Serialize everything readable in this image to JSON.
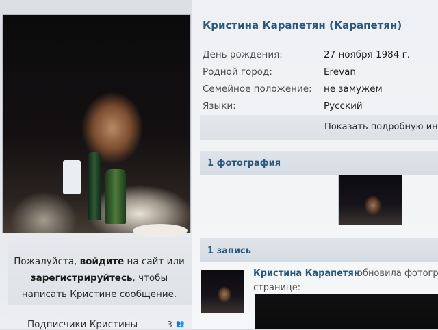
{
  "profile": {
    "name": "Кристина Карапетян (Карапетян)",
    "info": [
      {
        "label": "День рождения:",
        "value": "27 ноября 1984 г."
      },
      {
        "label": "Родной город:",
        "value": "Erevan"
      },
      {
        "label": "Семейное положение:",
        "value": "не замужем"
      },
      {
        "label": "Языки:",
        "value": "Русский"
      }
    ],
    "more_link": "Показать подробную инфо"
  },
  "login_prompt": {
    "line1_a": "Пожалуйста, ",
    "line1_link": "войдите",
    "line1_b": " на сайт или",
    "line2_link": "зарегистрируйтесь",
    "line2_b": ", чтобы",
    "line3": "написать Кристине сообщение."
  },
  "friends": {
    "title": "Подписчики Кристины",
    "count": "3"
  },
  "photos_section": {
    "title": "1 фотография"
  },
  "posts_section": {
    "title": "1 запись",
    "post": {
      "author": "Кристина Карапетян",
      "action": "обновила фотограф",
      "action_cont": "странице:"
    }
  },
  "colors": {
    "link": "#2b587a",
    "section_bar": "#d6dce4"
  }
}
